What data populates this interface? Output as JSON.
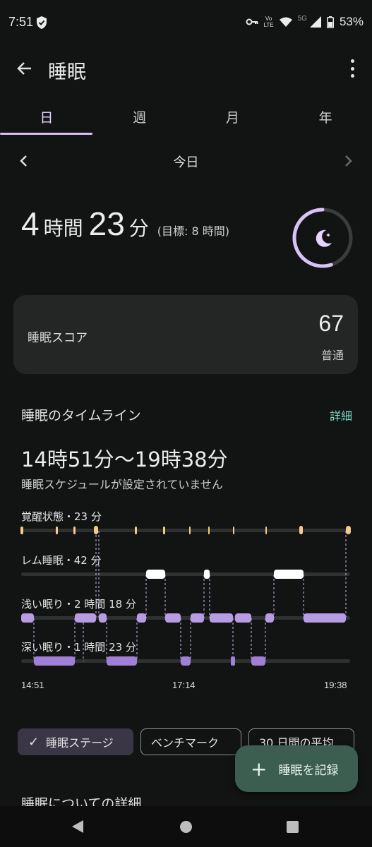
{
  "status_bar": {
    "time": "7:51",
    "network_volte": "Vo",
    "network_lte": "LTE",
    "network_5g": "5G",
    "battery": "53%"
  },
  "app_bar": {
    "title": "睡眠"
  },
  "tabs": [
    {
      "label": "日",
      "active": true
    },
    {
      "label": "週",
      "active": false
    },
    {
      "label": "月",
      "active": false
    },
    {
      "label": "年",
      "active": false
    }
  ],
  "date_nav": {
    "label": "今日"
  },
  "summary": {
    "hours": "4",
    "hours_unit": "時間",
    "minutes": "23",
    "minutes_unit": "分",
    "goal": "(目標: 8 時間)",
    "ring_progress": 0.55
  },
  "score_card": {
    "label": "睡眠スコア",
    "value": "67",
    "rating": "普通"
  },
  "timeline": {
    "title": "睡眠のタイムライン",
    "detail_link": "詳細",
    "time_range": "14時51分〜19時38分",
    "schedule_note": "睡眠スケジュールが設定されていません",
    "stages": [
      {
        "key": "awake",
        "label": "覚醒状態・23 分"
      },
      {
        "key": "rem",
        "label": "レム睡眠・42 分"
      },
      {
        "key": "light",
        "label": "浅い眠り・2 時間 18 分"
      },
      {
        "key": "deep",
        "label": "深い眠り・1 時間 23 分"
      }
    ],
    "axis": {
      "start": "14:51",
      "mid": "17:14",
      "end": "19:38"
    }
  },
  "chips": [
    {
      "label": "睡眠ステージ",
      "selected": true
    },
    {
      "label": "ベンチマーク",
      "selected": false
    },
    {
      "label": "30 日間の平均",
      "selected": false
    }
  ],
  "fab": {
    "label": "睡眠を記録"
  },
  "details_section": {
    "title": "睡眠についての詳細"
  },
  "colors": {
    "background": "#111413",
    "accent": "#d7bff6",
    "light_sleep": "#b79ce3",
    "deep_sleep": "#a07fd6",
    "rem": "#ffffff",
    "awake": "#f7c98a",
    "link": "#7cd9c4",
    "fab": "#3c5e51"
  },
  "icons": [
    "shield-check-icon",
    "vpn-key-icon",
    "wifi-icon",
    "signal-icon",
    "battery-icon",
    "back-arrow-icon",
    "more-vert-icon",
    "chevron-left-icon",
    "chevron-right-icon",
    "moon-stars-icon",
    "check-icon",
    "plus-icon"
  ]
}
